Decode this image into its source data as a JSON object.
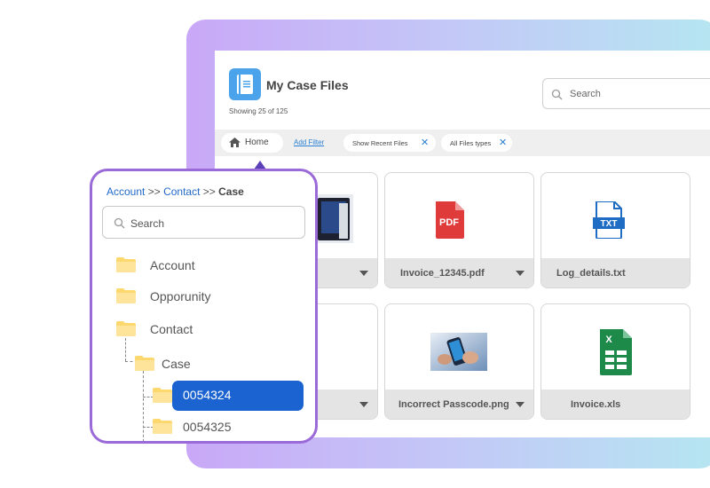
{
  "app": {
    "title": "My Case Files",
    "showing": "Showing 25 of 125",
    "icon": "notebook-icon"
  },
  "top_search": {
    "placeholder": "Search",
    "icon": "search-icon"
  },
  "filter_bar": {
    "home_label": "Home",
    "add_filter_label": "Add Filter",
    "chips": [
      {
        "label": "Show Recent Files"
      },
      {
        "label": "All Files types"
      }
    ]
  },
  "files": [
    {
      "name": "",
      "type": "image",
      "icon": "photo-thumbnail"
    },
    {
      "name": "Invoice_12345.pdf",
      "type": "pdf",
      "icon": "pdf-file-icon",
      "badge": "PDF"
    },
    {
      "name": "Log_details.txt",
      "type": "txt",
      "icon": "txt-file-icon",
      "badge": "TXT"
    },
    {
      "name": "",
      "type": "blank"
    },
    {
      "name": "Incorrect Passcode.png",
      "type": "png",
      "icon": "phone-photo-thumbnail"
    },
    {
      "name": "Invoice.xls",
      "type": "xls",
      "icon": "excel-file-icon",
      "badge": "X"
    }
  ],
  "tree": {
    "breadcrumb": {
      "items": [
        "Account",
        "Contact"
      ],
      "separator": ">>",
      "current": "Case"
    },
    "search_placeholder": "Search",
    "items": [
      {
        "label": "Account",
        "level": 0
      },
      {
        "label": "Opporunity",
        "level": 0
      },
      {
        "label": "Contact",
        "level": 0
      },
      {
        "label": "Case",
        "level": 1
      },
      {
        "label": "0054324",
        "level": 2,
        "selected": true
      },
      {
        "label": "0054325",
        "level": 2
      }
    ]
  },
  "colors": {
    "accent": "#1a63d0",
    "popup_border": "#9b6ad9",
    "folder": "#fcd86e",
    "pdf": "#e03b3b",
    "txt": "#1f6cc4",
    "xls": "#1e8a4a"
  }
}
